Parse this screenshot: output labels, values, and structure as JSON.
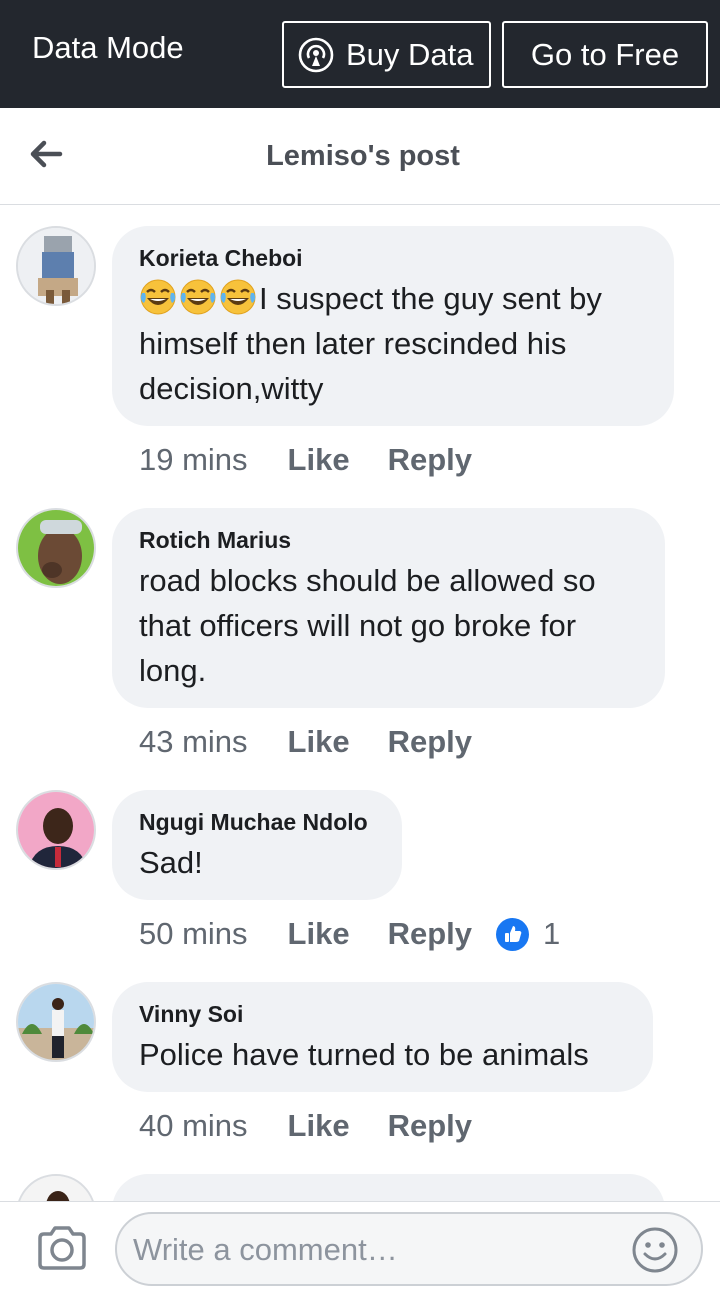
{
  "data_bar": {
    "title": "Data Mode",
    "buy_label": "Buy Data",
    "free_label": "Go to Free",
    "buy_icon": "broadcast-icon"
  },
  "header": {
    "title": "Lemiso's post",
    "back_icon": "back-arrow-icon"
  },
  "comments": [
    {
      "author": "Korieta Cheboi",
      "emoji": [
        "rolling-laughing-emoji",
        "rolling-laughing-emoji",
        "rolling-laughing-emoji"
      ],
      "text_line1": "I suspect the guy sent by",
      "text_rest": "himself then later rescinded his decision,witty",
      "time": "19 mins",
      "like": "Like",
      "reply": "Reply"
    },
    {
      "author": "Rotich Marius",
      "text": "road blocks should be allowed so that officers will not go broke for long.",
      "time": "43 mins",
      "like": "Like",
      "reply": "Reply"
    },
    {
      "author": "Ngugi Muchae Ndolo",
      "text": "Sad!",
      "time": "50 mins",
      "like": "Like",
      "reply": "Reply",
      "reaction_count": "1"
    },
    {
      "author": "Vinny Soi",
      "text": "Police have turned to be animals",
      "time": "40 mins",
      "like": "Like",
      "reply": "Reply"
    }
  ],
  "composer": {
    "placeholder": "Write a comment…",
    "camera_icon": "camera-icon",
    "emoji_icon": "smiley-icon"
  },
  "colors": {
    "top_bar": "#23272e",
    "bubble": "#f0f2f5",
    "like_blue": "#1877f2",
    "meta_gray": "#606770"
  }
}
